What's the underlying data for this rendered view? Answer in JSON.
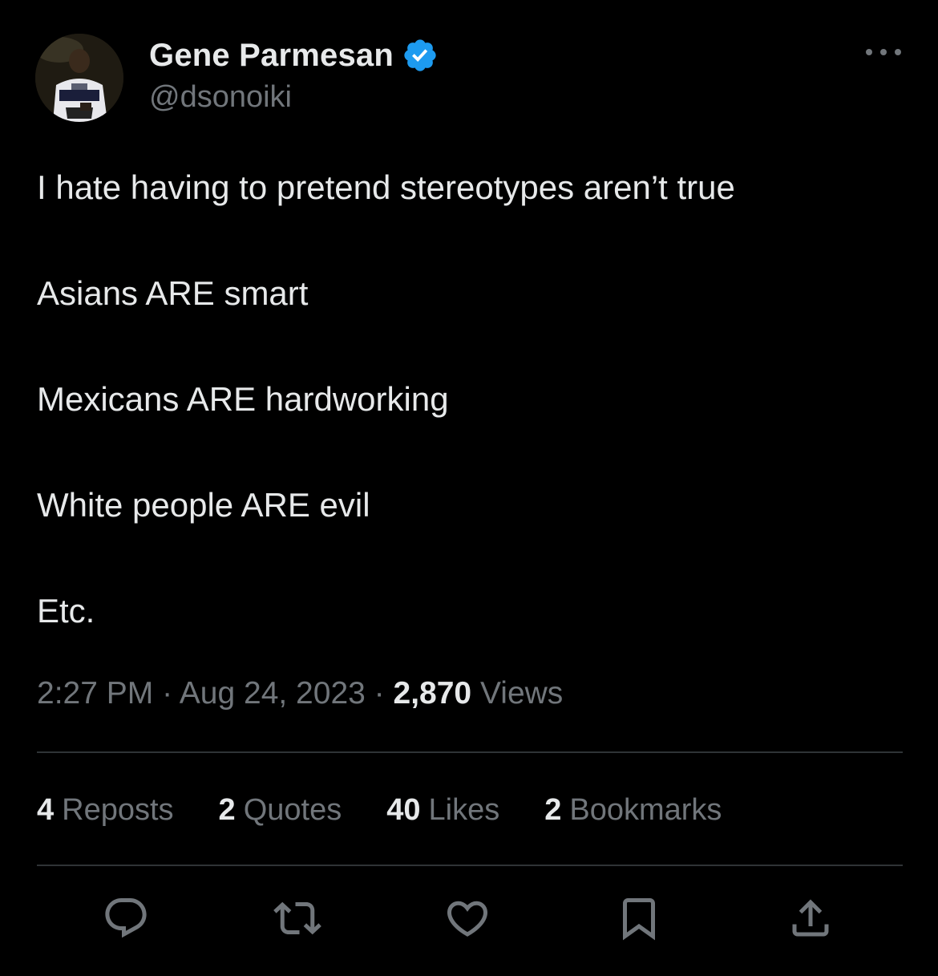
{
  "author": {
    "display_name": "Gene Parmesan",
    "handle": "@dsonoiki",
    "verified_icon": "verified-badge-icon",
    "verified_color": "#1d9bf0"
  },
  "post": {
    "lines": [
      "I hate having to pretend stereotypes aren’t true",
      "Asians ARE smart",
      "Mexicans ARE hardworking",
      "White people ARE evil",
      "Etc."
    ]
  },
  "meta": {
    "time": "2:27 PM",
    "separator": "·",
    "date": "Aug 24, 2023",
    "views_count": "2,870",
    "views_label": "Views"
  },
  "stats": [
    {
      "count": "4",
      "label": "Reposts"
    },
    {
      "count": "2",
      "label": "Quotes"
    },
    {
      "count": "40",
      "label": "Likes"
    },
    {
      "count": "2",
      "label": "Bookmarks"
    }
  ],
  "actions": [
    "reply-icon",
    "repost-icon",
    "like-icon",
    "bookmark-icon",
    "share-icon"
  ],
  "colors": {
    "background": "#000000",
    "text_primary": "#e7e9ea",
    "text_secondary": "#71767b",
    "divider": "#2f3336"
  }
}
